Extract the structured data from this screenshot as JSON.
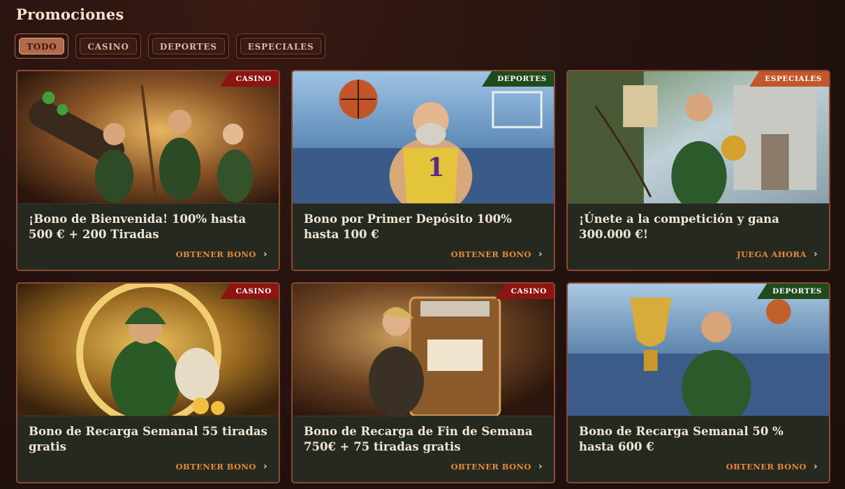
{
  "page": {
    "title": "Promociones"
  },
  "filters": [
    {
      "label": "TODO",
      "active": true
    },
    {
      "label": "CASINO",
      "active": false
    },
    {
      "label": "DEPORTES",
      "active": false
    },
    {
      "label": "ESPECIALES",
      "active": false
    }
  ],
  "colors": {
    "casino_tag": "#8c1412",
    "deportes_tag": "#1f4a1c",
    "especiales_tag": "#c4572a",
    "cta": "#e68a3a"
  },
  "promos": [
    {
      "tag": "CASINO",
      "title": "¡Bono de Bienvenida! 100% hasta 500 € + 200 Tiradas",
      "cta": "OBTENER BONO",
      "image": "archers-cannon-casino-art"
    },
    {
      "tag": "DEPORTES",
      "title": "Bono por Primer Depósito 100% hasta 100 €",
      "cta": "OBTENER BONO",
      "image": "basketball-player-art"
    },
    {
      "tag": "ESPECIALES",
      "title": "¡Únete a la competición y gana 300.000 €!",
      "cta": "JUEGA AHORA",
      "image": "archer-castle-art"
    },
    {
      "tag": "CASINO",
      "title": "Bono de Recarga Semanal 55 tiradas gratis",
      "cta": "OBTENER BONO",
      "image": "vault-archer-art"
    },
    {
      "tag": "CASINO",
      "title": "Bono de Recarga de Fin de Semana 750€ + 75 tiradas gratis",
      "cta": "OBTENER BONO",
      "image": "slot-machine-archer-art"
    },
    {
      "tag": "DEPORTES",
      "title": "Bono de Recarga Semanal 50 % hasta 600 €",
      "cta": "OBTENER BONO",
      "image": "trophy-stadium-art"
    }
  ]
}
